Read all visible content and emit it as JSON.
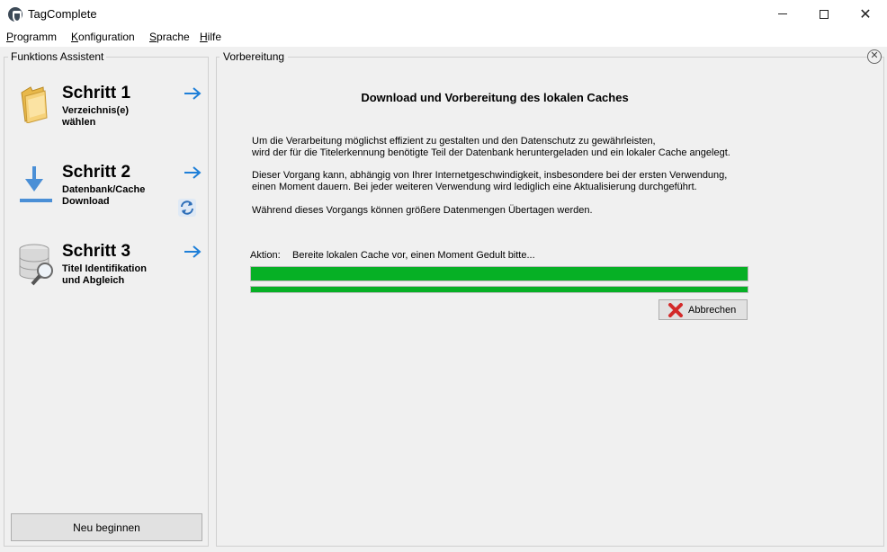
{
  "window": {
    "title": "TagComplete",
    "close_glyph": "✕"
  },
  "menu": {
    "items": [
      {
        "first": "P",
        "rest": "rogramm"
      },
      {
        "first": "K",
        "rest": "onfiguration"
      },
      {
        "first": "S",
        "rest": "prache"
      },
      {
        "first": "H",
        "rest": "ilfe"
      }
    ]
  },
  "sidebar": {
    "title": "Funktions Assistent",
    "steps": [
      {
        "heading": "Schritt 1",
        "sub1": "Verzeichnis(e)",
        "sub2": "wählen",
        "icon": "folder-icon"
      },
      {
        "heading": "Schritt 2",
        "sub1": "Datenbank/Cache",
        "sub2": "Download",
        "icon": "download-icon"
      },
      {
        "heading": "Schritt 3",
        "sub1": "Titel Identifikation",
        "sub2": "und Abgleich",
        "icon": "database-search-icon"
      }
    ],
    "restart_label": "Neu beginnen"
  },
  "main": {
    "group_title": "Vorbereitung",
    "close_glyph": "✕",
    "heading": "Download und Vorbereitung des lokalen Caches",
    "para1_line1": "Um die Verarbeitung möglichst effizient zu gestalten und den Datenschutz zu gewährleisten,",
    "para1_line2": "wird der für die Titelerkennung benötigte Teil der Datenbank heruntergeladen und ein lokaler Cache angelegt.",
    "para2_line1": "Dieser Vorgang kann, abhängig von Ihrer Internetgeschwindigkeit, insbesondere bei der ersten Verwendung,",
    "para2_line2": "einen Moment dauern. Bei jeder weiteren Verwendung wird lediglich eine Aktualisierung durchgeführt.",
    "para3": "Während dieses Vorgangs können größere Datenmengen Übertagen werden.",
    "action_label": "Aktion:",
    "action_text": "Bereite lokalen Cache vor, einen Moment Gedult bitte...",
    "progress1_percent": 100,
    "progress2_percent": 100,
    "cancel_label": "Abbrechen"
  },
  "colors": {
    "progress": "#06b025",
    "accent_arrow": "#1e7fd8"
  }
}
